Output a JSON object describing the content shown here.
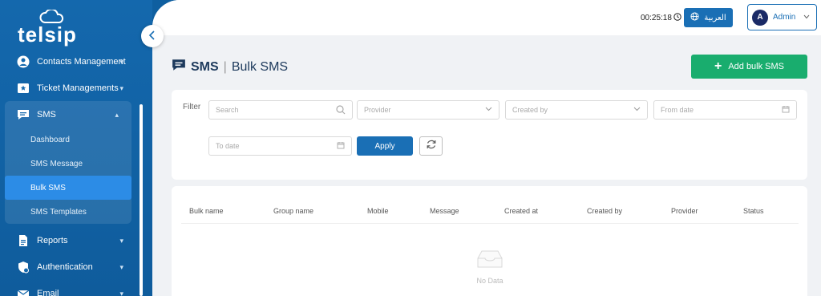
{
  "brand": {
    "logo_text": "telsip"
  },
  "sidebar": {
    "items": [
      {
        "label": "Contacts Management",
        "icon": "user-icon"
      },
      {
        "label": "Ticket Managements",
        "icon": "ticket-icon"
      },
      {
        "label": "SMS",
        "icon": "sms-icon",
        "expanded": true,
        "children": [
          "Dashboard",
          "SMS Message",
          "Bulk SMS",
          "SMS Templates"
        ],
        "active_child": "Bulk SMS"
      },
      {
        "label": "Reports",
        "icon": "report-icon"
      },
      {
        "label": "Authentication",
        "icon": "shield-icon"
      },
      {
        "label": "Email",
        "icon": "email-icon"
      }
    ]
  },
  "header": {
    "clock": "00:25:18",
    "language_label": "العربية",
    "user": {
      "avatar_letter": "A",
      "name": "Admin"
    }
  },
  "page": {
    "title_main": "SMS",
    "title_sub": "Bulk SMS",
    "add_button": "Add bulk SMS"
  },
  "filter": {
    "label": "Filter",
    "search_placeholder": "Search",
    "provider_placeholder": "Provider",
    "created_by_placeholder": "Created by",
    "from_date_placeholder": "From date",
    "to_date_placeholder": "To date",
    "apply_label": "Apply"
  },
  "table": {
    "columns": [
      "Bulk name",
      "Group name",
      "Mobile",
      "Message",
      "Created at",
      "Created by",
      "Provider",
      "Status"
    ],
    "empty_text": "No Data"
  },
  "colors": {
    "primary": "#1a6fb5",
    "success": "#19ad6e",
    "sidebar": "#1468ad",
    "active": "#2c8ce6"
  }
}
